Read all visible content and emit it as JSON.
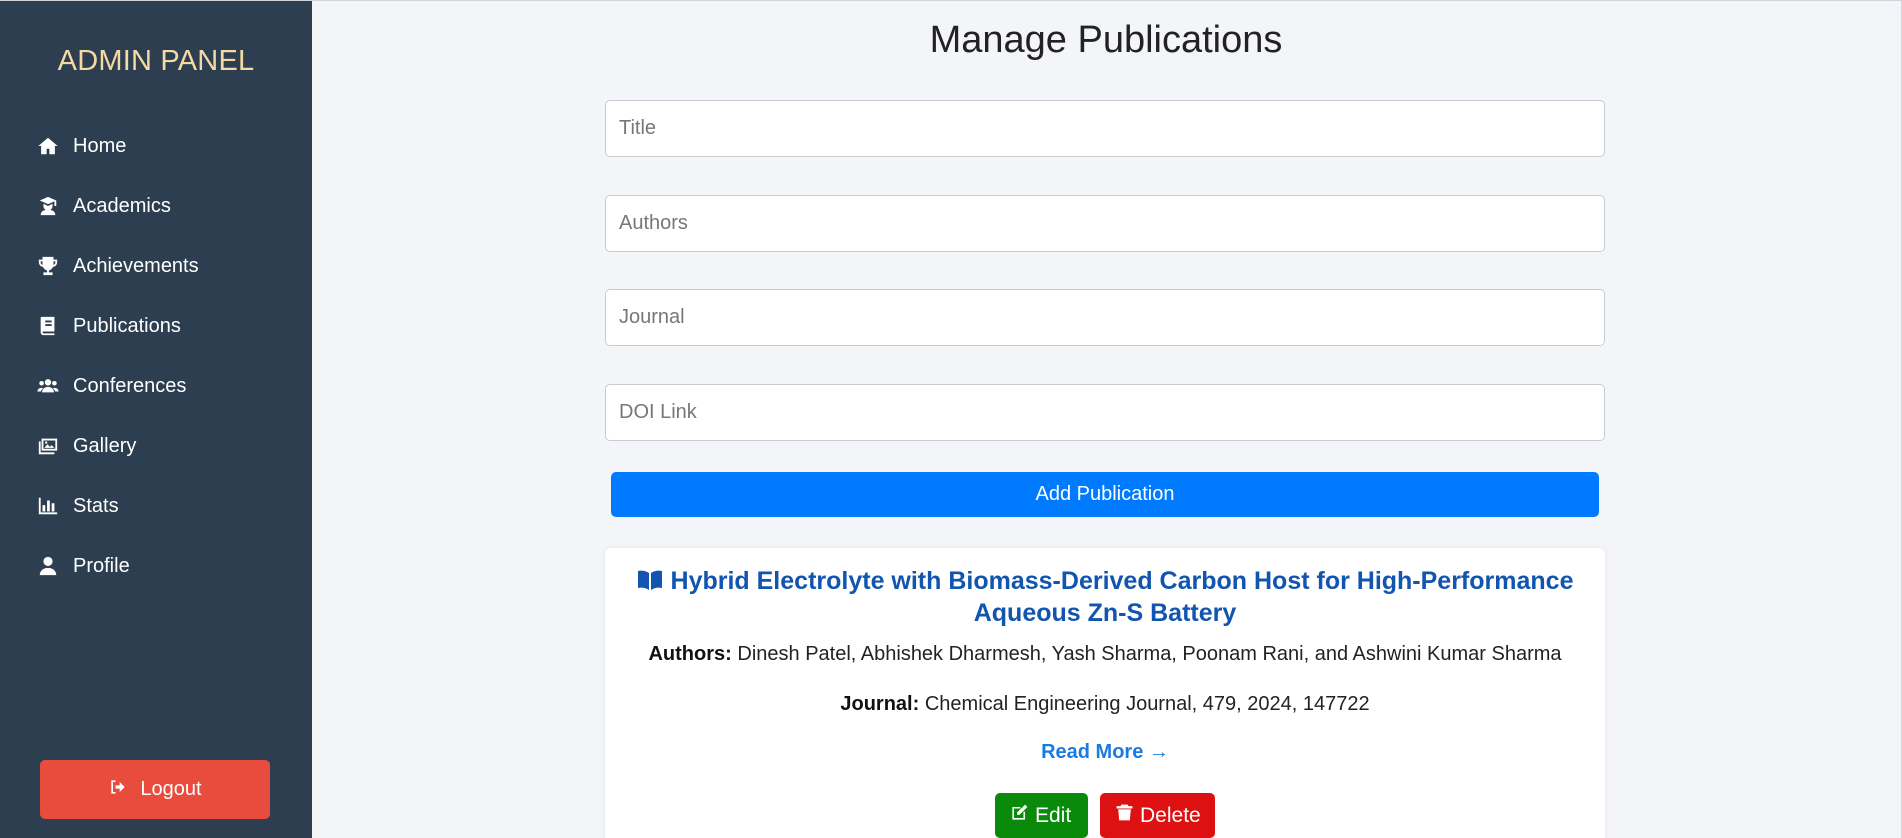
{
  "sidebar": {
    "brand": "ADMIN PANEL",
    "items": [
      {
        "label": "Home",
        "icon": "home-icon"
      },
      {
        "label": "Academics",
        "icon": "graduate-icon"
      },
      {
        "label": "Achievements",
        "icon": "trophy-icon"
      },
      {
        "label": "Publications",
        "icon": "book-icon"
      },
      {
        "label": "Conferences",
        "icon": "users-icon"
      },
      {
        "label": "Gallery",
        "icon": "images-icon"
      },
      {
        "label": "Stats",
        "icon": "bar-chart-icon"
      },
      {
        "label": "Profile",
        "icon": "user-icon"
      }
    ],
    "logout_label": "Logout"
  },
  "main": {
    "title": "Manage Publications",
    "form": {
      "title_placeholder": "Title",
      "authors_placeholder": "Authors",
      "journal_placeholder": "Journal",
      "doi_placeholder": "DOI Link",
      "submit_label": "Add Publication"
    },
    "publications": [
      {
        "title": "Hybrid Electrolyte with Biomass-Derived Carbon Host for High-Performance Aqueous Zn-S Battery",
        "authors_label": "Authors:",
        "authors": "Dinesh Patel, Abhishek Dharmesh, Yash Sharma, Poonam Rani, and Ashwini Kumar Sharma",
        "journal_label": "Journal:",
        "journal": "Chemical Engineering Journal, 479, 2024, 147722",
        "read_more": "Read More →",
        "edit_label": "Edit",
        "delete_label": "Delete"
      }
    ]
  },
  "colors": {
    "sidebar_bg": "#2c3e50",
    "brand": "#f3d9a4",
    "logout": "#e74c3c",
    "primary": "#007bff",
    "edit": "#0a8a0a",
    "delete": "#dd1111",
    "pub_title": "#1155b0"
  }
}
